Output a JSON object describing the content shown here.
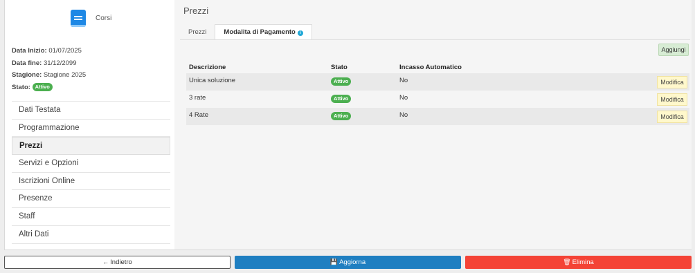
{
  "app": {
    "name": "Corsi"
  },
  "info": {
    "start_label": "Data Inizio:",
    "start_value": "01/07/2025",
    "end_label": "Data fine:",
    "end_value": "31/12/2099",
    "season_label": "Stagione:",
    "season_value": "Stagione 2025",
    "status_label": "Stato:",
    "status_value": "Attivo"
  },
  "nav": [
    {
      "label": "Dati Testata"
    },
    {
      "label": "Programmazione"
    },
    {
      "label": "Prezzi",
      "active": true
    },
    {
      "label": "Servizi e Opzioni"
    },
    {
      "label": "Iscrizioni Online"
    },
    {
      "label": "Presenze"
    },
    {
      "label": "Staff"
    },
    {
      "label": "Altri Dati"
    }
  ],
  "main": {
    "title": "Prezzi",
    "tabs": [
      {
        "label": "Prezzi"
      },
      {
        "label": "Modalita di Pagamento",
        "active": true
      }
    ],
    "add_label": "Aggiungi",
    "columns": [
      "Descrizione",
      "Stato",
      "Incasso Automatico"
    ],
    "rows": [
      {
        "desc": "Unica soluzione",
        "status": "Attivo",
        "auto": "No",
        "action": "Modifica"
      },
      {
        "desc": "3 rate",
        "status": "Attivo",
        "auto": "No",
        "action": "Modifica"
      },
      {
        "desc": "4 Rate",
        "status": "Attivo",
        "auto": "No",
        "action": "Modifica"
      }
    ]
  },
  "footer": {
    "back_label": "Indietro",
    "update_label": "Aggiorna",
    "delete_label": "Elimina"
  },
  "colors": {
    "primary": "#1f7fc1",
    "danger": "#f44336",
    "success": "#4caf50",
    "add_bg": "#d7ecd4",
    "edit_bg": "#fff8cc"
  }
}
